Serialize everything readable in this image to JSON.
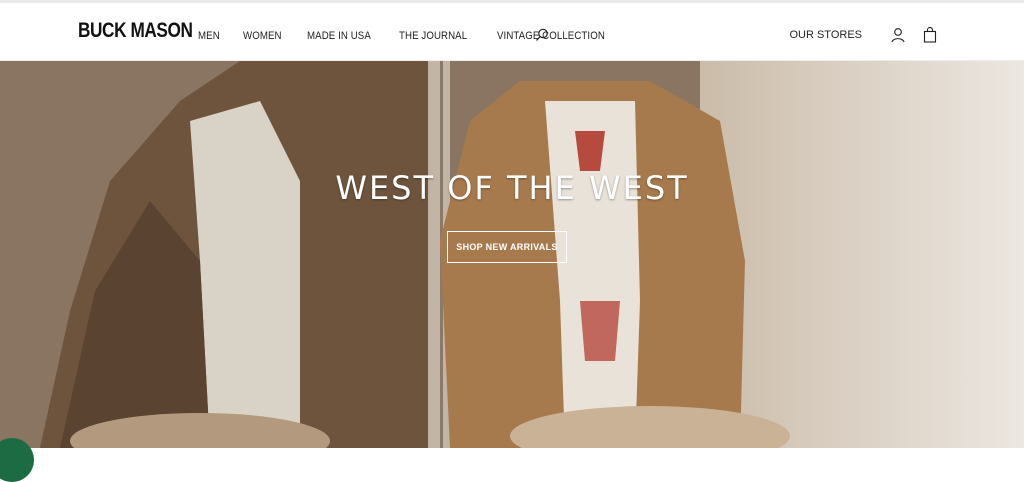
{
  "brand": {
    "name": "BUCK MASON"
  },
  "nav": {
    "items": [
      {
        "label": "MEN"
      },
      {
        "label": "WOMEN"
      },
      {
        "label": "MADE IN USA"
      },
      {
        "label": "THE JOURNAL"
      },
      {
        "label": "VINTAGE COLLECTION"
      }
    ]
  },
  "utility": {
    "stores_label": "OUR STORES"
  },
  "hero": {
    "headline": "WEST OF THE WEST",
    "cta_label": "SHOP NEW ARRIVALS"
  },
  "icons": {
    "search": "search-icon",
    "account": "user-icon",
    "bag": "shopping-bag-icon"
  },
  "colors": {
    "text": "#222222",
    "cta_border": "#ffffff",
    "chat": "#1c6b43"
  }
}
